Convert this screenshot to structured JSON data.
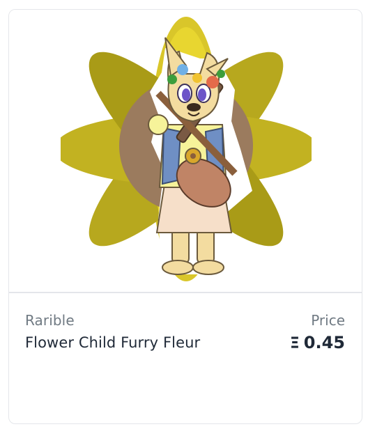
{
  "card": {
    "collection": "Rarible",
    "title": "Flower Child Furry Fleur",
    "price_label": "Price",
    "currency_symbol": "Ξ",
    "price_value": "0.45",
    "image_alt": "Flower Child Furry Fleur artwork"
  },
  "colors": {
    "border": "#e4e6ea",
    "muted_text": "#707a83",
    "primary_text": "#1f2937",
    "petal_light": "#e6d228",
    "petal_dark": "#b6a61c",
    "accent_brown": "#9a7b5c"
  },
  "icons": {
    "currency": "ethereum-icon"
  }
}
